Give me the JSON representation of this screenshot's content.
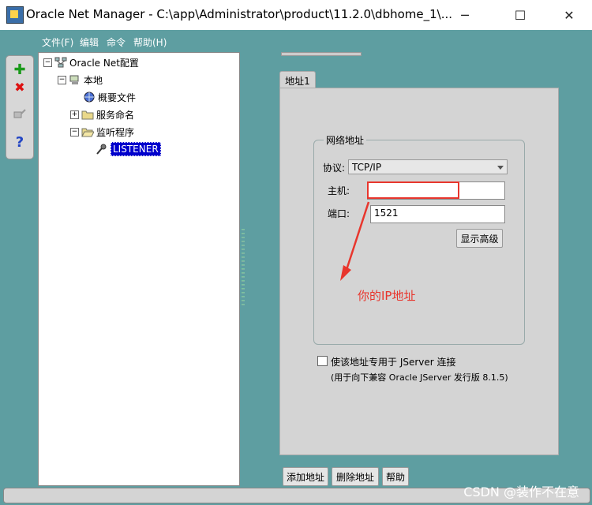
{
  "window": {
    "title": "Oracle Net Manager - C:\\app\\Administrator\\product\\11.2.0\\dbhome_1\\...",
    "minimize_glyph": "─",
    "maximize_glyph": "☐",
    "close_glyph": "✕"
  },
  "menu": [
    "文件(F)",
    "编辑",
    "命令",
    "帮助(H)"
  ],
  "toolbar": {
    "add_glyph": "✚",
    "delete_glyph": "✖",
    "help_glyph": "?"
  },
  "tree": {
    "root": "Oracle Net配置",
    "local": "本地",
    "profile": "概要文件",
    "service_naming": "服务命名",
    "listeners": "监听程序",
    "listener": "LISTENER",
    "expanded_glyph": "−",
    "collapsed_glyph": "+"
  },
  "tab": {
    "label": "地址1"
  },
  "group": {
    "title": "网络地址",
    "protocol_label": "协议:",
    "protocol_value": "TCP/IP",
    "host_label": "主机:",
    "host_value": "",
    "port_label": "端口:",
    "port_value": "1521",
    "advanced_button": "显示高级"
  },
  "annotation": "你的IP地址",
  "jserver": {
    "checkbox_label": "使该地址专用于 JServer 连接",
    "note": "(用于向下兼容 Oracle JServer 发行版 8.1.5)"
  },
  "buttons": {
    "add_address": "添加地址",
    "delete_address": "删除地址",
    "help": "帮助"
  },
  "watermark": "CSDN @装作不在意",
  "colors": {
    "desktop": "#5e9ea1",
    "selection": "#0000cc",
    "annotation": "#e8362d"
  }
}
